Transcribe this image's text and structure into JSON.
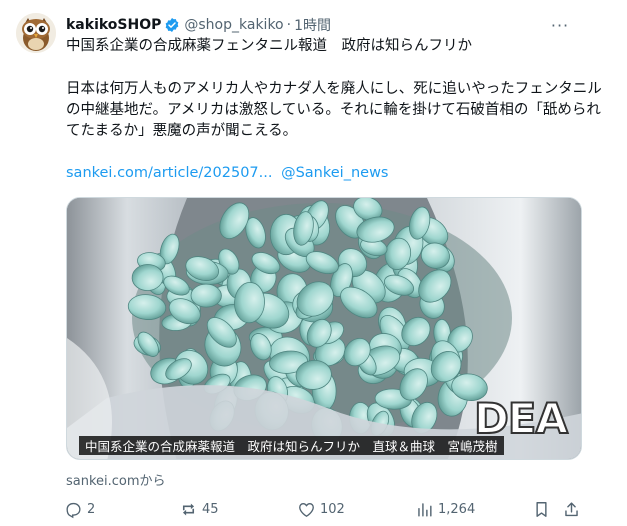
{
  "tweet": {
    "display_name": "kakikoSHOP",
    "handle": "@shop_kakiko",
    "separator": "·",
    "time": "1時間",
    "more_label": "···",
    "line1": "中国系企業の合成麻薬フェンタニル報道　政府は知らんフリか",
    "para2": "日本は何万人ものアメリカ人やカナダ人を廃人にし、死に追いやったフェンタニルの中継基地だ。アメリカは激怒している。それに輪を掛けて石破首相の「舐められてたまるか」悪魔の声が聞こえる。",
    "link_url": "sankei.com/article/202507...",
    "link_mention": "@Sankei_news",
    "media_caption": "中国系企業の合成麻薬報道　政府は知らんフリか　直球＆曲球　宮嶋茂樹",
    "media_watermark": "DEA",
    "source": "sankei.comから"
  },
  "actions": {
    "reply_count": "2",
    "repost_count": "45",
    "like_count": "102",
    "views_count": "1,264"
  },
  "colors": {
    "accent": "#1d9bf0",
    "muted": "#536471",
    "text": "#0f1419",
    "verified_badge": "#1d9bf0",
    "pill_color": "#9fd6cf"
  },
  "icons": [
    "owl-avatar",
    "verified-icon",
    "more-icon",
    "reply-icon",
    "repost-icon",
    "like-icon",
    "views-icon",
    "bookmark-icon",
    "share-icon"
  ]
}
